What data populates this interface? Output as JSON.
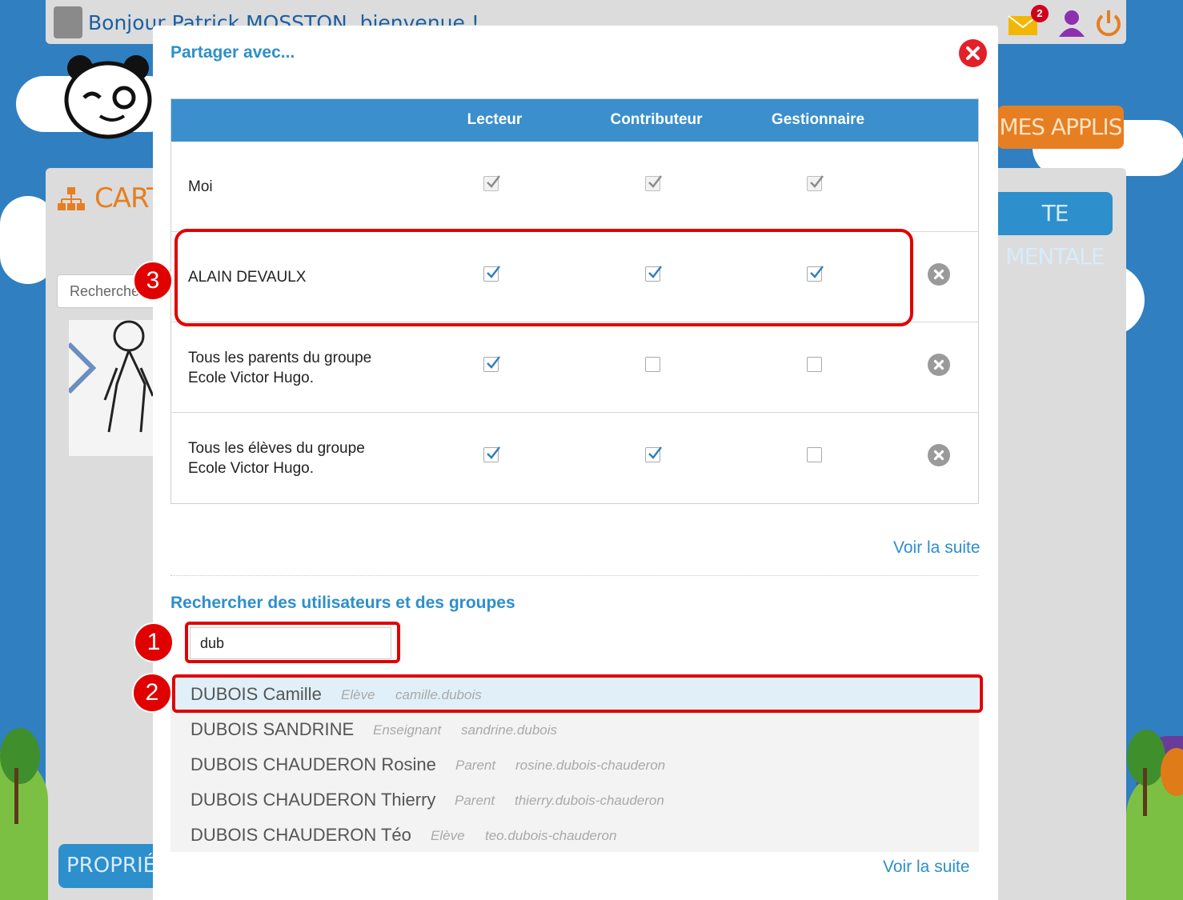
{
  "background": {
    "greeting": "Bonjour Patrick MOSSTON, bienvenue !",
    "notification_count": "2",
    "page_title": "CARTE",
    "mes_applis": "MES APPLIS",
    "carte_mentale": "TE MENTALE",
    "search_placeholder": "Recherche",
    "proprietes": "PROPRIÉTÉS",
    "icons": [
      "mail-icon",
      "user-icon",
      "power-icon",
      "org-chart-icon"
    ]
  },
  "modal": {
    "title": "Partager avec...",
    "close_icon": "close-icon",
    "columns": [
      "Lecteur",
      "Contributeur",
      "Gestionnaire"
    ],
    "rows": [
      {
        "name_line1": "Moi",
        "name_line2": "",
        "lecteur": true,
        "contributeur": true,
        "gestionnaire": true,
        "disabled": true,
        "removable": false
      },
      {
        "name_line1": "ALAIN DEVAULX",
        "name_line2": "",
        "lecteur": true,
        "contributeur": true,
        "gestionnaire": true,
        "disabled": false,
        "removable": true
      },
      {
        "name_line1": "Tous les parents du groupe",
        "name_line2": "Ecole Victor Hugo.",
        "lecteur": true,
        "contributeur": false,
        "gestionnaire": false,
        "disabled": false,
        "removable": true
      },
      {
        "name_line1": "Tous les élèves du groupe",
        "name_line2": "Ecole Victor Hugo.",
        "lecteur": true,
        "contributeur": true,
        "gestionnaire": false,
        "disabled": false,
        "removable": true
      }
    ],
    "voir_la_suite_1": "Voir la suite",
    "search_title": "Rechercher des utilisateurs et des groupes",
    "search_value": "dub",
    "results": [
      {
        "name": "DUBOIS Camille",
        "role": "Elève",
        "login": "camille.dubois",
        "active": true
      },
      {
        "name": "DUBOIS SANDRINE",
        "role": "Enseignant",
        "login": "sandrine.dubois",
        "active": false
      },
      {
        "name": "DUBOIS CHAUDERON Rosine",
        "role": "Parent",
        "login": "rosine.dubois-chauderon",
        "active": false
      },
      {
        "name": "DUBOIS CHAUDERON Thierry",
        "role": "Parent",
        "login": "thierry.dubois-chauderon",
        "active": false
      },
      {
        "name": "DUBOIS CHAUDERON Téo",
        "role": "Elève",
        "login": "teo.dubois-chauderon",
        "active": false
      }
    ],
    "voir_la_suite_2": "Voir la suite"
  },
  "annotations": {
    "marker_1": "1",
    "marker_2": "2",
    "marker_3": "3"
  },
  "colors": {
    "accent": "#2d8fcb",
    "header": "#3a8fcc",
    "close": "#e2202a",
    "highlight": "#e00000"
  }
}
